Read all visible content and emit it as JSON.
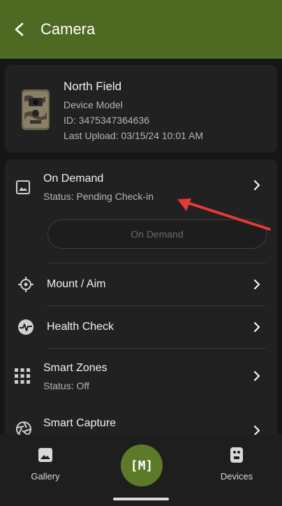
{
  "appbar": {
    "title": "Camera"
  },
  "device": {
    "name": "North Field",
    "model": "Device Model",
    "id_line": "ID: 3475347364636",
    "last_upload": "Last Upload: 03/15/24 10:01 AM"
  },
  "menu": {
    "on_demand": {
      "title": "On Demand",
      "status": "Status: Pending Check-in",
      "button_label": "On Demand"
    },
    "mount_aim": {
      "title": "Mount / Aim"
    },
    "health_check": {
      "title": "Health Check"
    },
    "smart_zones": {
      "title": "Smart Zones",
      "status": "Status: Off"
    },
    "smart_capture": {
      "title": "Smart Capture"
    }
  },
  "bottom_nav": {
    "gallery": "Gallery",
    "center": "[M]",
    "devices": "Devices"
  },
  "colors": {
    "appbar": "#4e6a22",
    "fab": "#5c7a28",
    "annotation_arrow": "#e53935"
  },
  "icons": {
    "back": "back-arrow-icon",
    "gallery": "image-icon",
    "devices": "camera-device-icon"
  }
}
